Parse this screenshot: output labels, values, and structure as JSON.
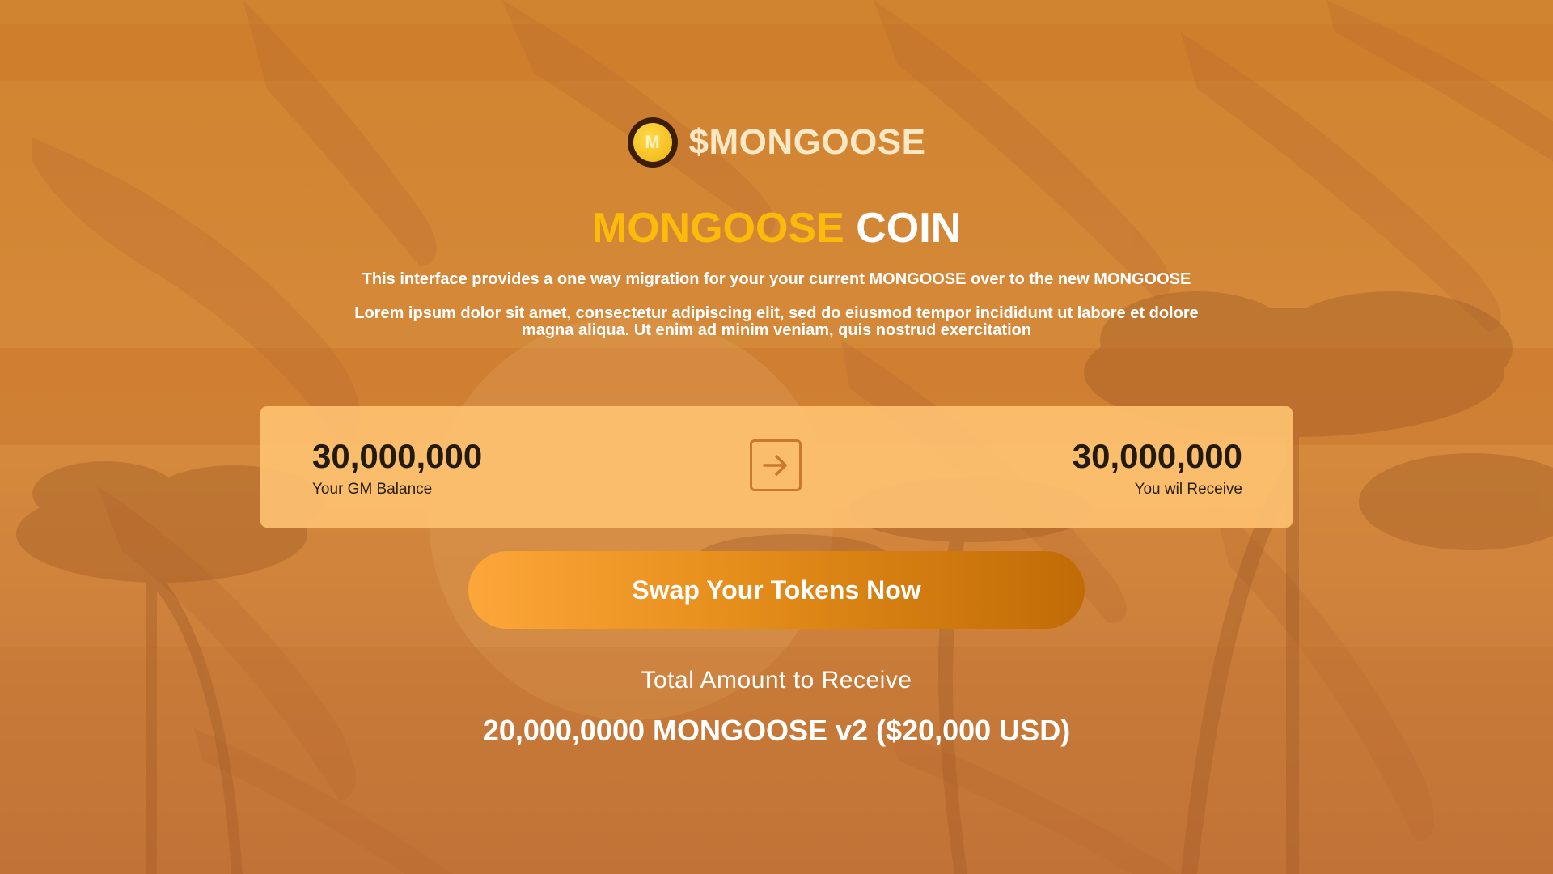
{
  "brand": {
    "logo_letter": "M",
    "logo_text": "$MONGOOSE"
  },
  "hero": {
    "title_highlight": "MONGOOSE",
    "title_rest": "COIN",
    "description": "This interface provides a one way migration for your your current MONGOOSE over to the new MONGOOSE",
    "lorem": "Lorem ipsum dolor sit amet, consectetur adipiscing elit, sed do eiusmod tempor incididunt ut labore et dolore magna aliqua. Ut enim ad minim veniam, quis nostrud exercitation"
  },
  "swap": {
    "balance_amount": "30,000,000",
    "balance_label": "Your GM Balance",
    "receive_amount": "30,000,000",
    "receive_label": "You wil Receive",
    "arrow_icon": "arrow-right-icon",
    "button_label": "Swap Your Tokens Now"
  },
  "total": {
    "label": "Total Amount to Receive",
    "value": "20,000,0000 MONGOOSE v2 ($20,000 USD)"
  },
  "colors": {
    "background": "#cd7d34",
    "accent_yellow": "#fcbb0a",
    "panel": "#fdc170",
    "button_start": "#fda63a",
    "button_end": "#c06b06"
  }
}
